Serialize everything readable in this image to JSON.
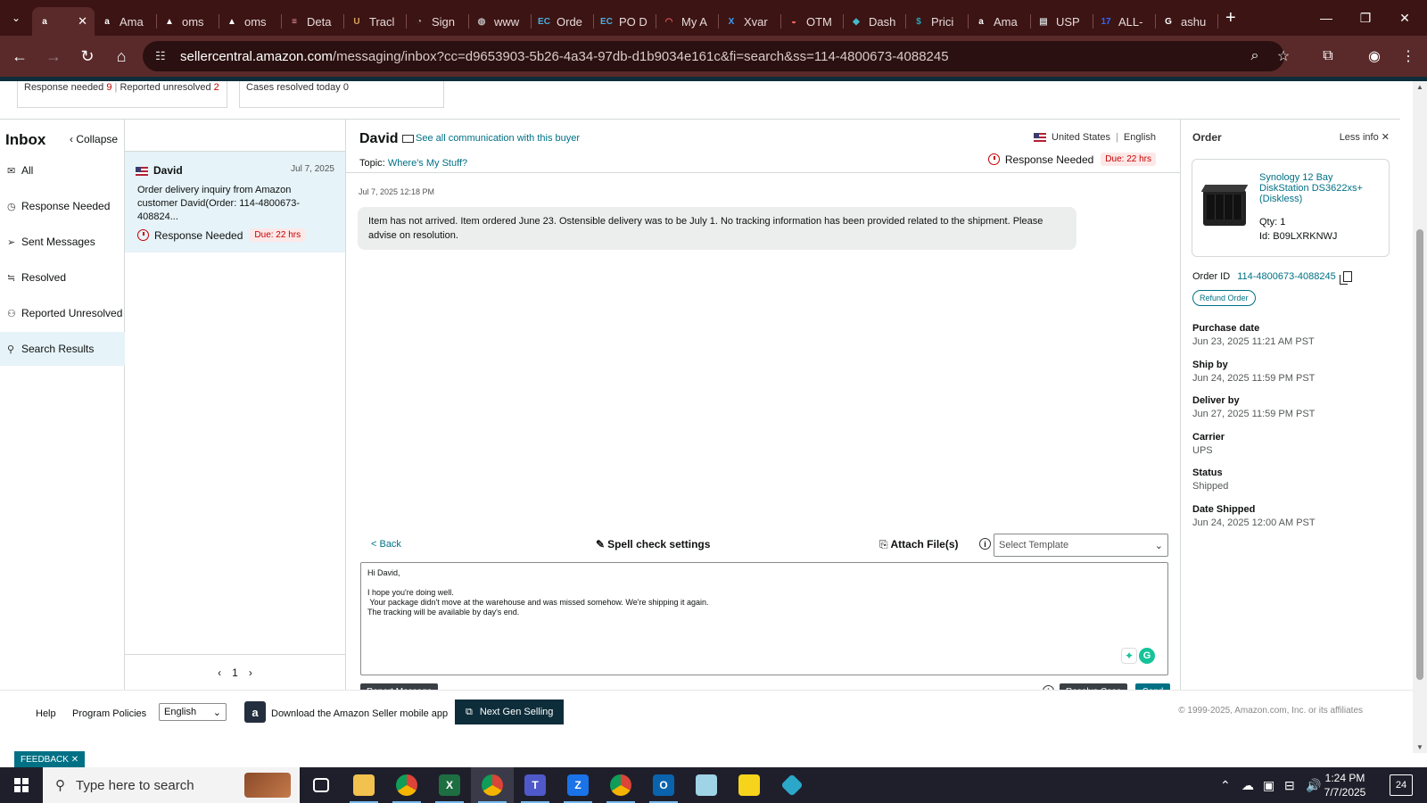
{
  "browser": {
    "tabs": [
      {
        "icon": "a",
        "label": "",
        "color": "#fff"
      },
      {
        "icon": "a",
        "label": "Ama",
        "color": "#fff"
      },
      {
        "icon": "▲",
        "label": "oms",
        "color": "#fff"
      },
      {
        "icon": "▲",
        "label": "oms",
        "color": "#fff"
      },
      {
        "icon": "≡",
        "label": "Deta",
        "color": "#f9a"
      },
      {
        "icon": "U",
        "label": "Tracl",
        "color": "#d9a55a"
      },
      {
        "icon": "◔",
        "label": "Sign",
        "color": "#bbb"
      },
      {
        "icon": "◍",
        "label": "www",
        "color": "#bbb"
      },
      {
        "icon": "EC",
        "label": "Orde",
        "color": "#4ab0e0"
      },
      {
        "icon": "EC",
        "label": "PO D",
        "color": "#4ab0e0"
      },
      {
        "icon": "◠",
        "label": "My A",
        "color": "#e55"
      },
      {
        "icon": "X",
        "label": "Xvar",
        "color": "#3aa0ff"
      },
      {
        "icon": "◒",
        "label": "OTM",
        "color": "#f66"
      },
      {
        "icon": "◆",
        "label": "Dash",
        "color": "#4bc"
      },
      {
        "icon": "$",
        "label": "Prici",
        "color": "#2ab"
      },
      {
        "icon": "a",
        "label": "Ama",
        "color": "#fff"
      },
      {
        "icon": "▤",
        "label": "USP",
        "color": "#ccc"
      },
      {
        "icon": "17",
        "label": "ALL-",
        "color": "#36f"
      },
      {
        "icon": "G",
        "label": "ashu",
        "color": "#fff"
      }
    ],
    "url_host": "sellercentral.amazon.com",
    "url_path": "/messaging/inbox?cc=d9653903-5b26-4a34-97db-d1b9034e161c&fi=search&ss=114-4800673-4088245"
  },
  "stats": {
    "response_needed_label": "Response needed",
    "response_needed_count": "9",
    "reported_unresolved_label": "Reported unresolved",
    "reported_unresolved_count": "2",
    "cases_resolved_label": "Cases resolved today",
    "cases_resolved_count": "0"
  },
  "sidebar": {
    "title": "Inbox",
    "collapse": "Collapse",
    "items": [
      {
        "label": "All",
        "icon": "mail-icon"
      },
      {
        "label": "Response Needed",
        "icon": "clock-icon"
      },
      {
        "label": "Sent Messages",
        "icon": "send-icon"
      },
      {
        "label": "Resolved",
        "icon": "resolved-icon"
      },
      {
        "label": "Reported Unresolved",
        "icon": "report-icon"
      },
      {
        "label": "Search Results",
        "icon": "search-icon"
      }
    ]
  },
  "conversation": {
    "name": "David",
    "date": "Jul 7, 2025",
    "snippet": "Order delivery inquiry from Amazon customer David(Order: 114-4800673-408824...",
    "status": "Response Needed",
    "due": "Due: 22 hrs",
    "page": "1"
  },
  "thread": {
    "buyer": "David",
    "see_all": "See all communication with this buyer",
    "topic_label": "Topic:",
    "topic": "Where's My Stuff?",
    "country": "United States",
    "language": "English",
    "status": "Response Needed",
    "due": "Due: 22 hrs",
    "message_time": "Jul 7, 2025 12:18 PM",
    "message": "Item has not arrived.  Item ordered June 23.  Ostensible delivery was to be July 1.  No tracking information has been provided related to the shipment.  Please advise on resolution."
  },
  "composer": {
    "back": "< Back",
    "spell": "Spell check settings",
    "attach": "Attach File(s)",
    "template_placeholder": "Select Template",
    "reply_lines": [
      "Hi David,",
      "",
      "I hope you're doing well.",
      " Your package didn't move at the warehouse and was missed somehow. We're shipping it again.",
      "The tracking will be available by day's end."
    ],
    "report": "Report Message",
    "resolve": "Resolve Case",
    "send": "Send"
  },
  "order": {
    "title": "Order",
    "less_info": "Less info",
    "product_title": "Synology 12 Bay DiskStation DS3622xs+ (Diskless)",
    "qty_label": "Qty:",
    "qty": "1",
    "id_label": "Id:",
    "asin": "B09LXRKNWJ",
    "order_id_label": "Order ID",
    "order_id": "114-4800673-4088245",
    "refund": "Refund Order",
    "fields": [
      {
        "label": "Purchase date",
        "value": "Jun 23, 2025 11:21 AM PST"
      },
      {
        "label": "Ship by",
        "value": "Jun 24, 2025 11:59 PM PST"
      },
      {
        "label": "Deliver by",
        "value": "Jun 27, 2025 11:59 PM PST"
      },
      {
        "label": "Carrier",
        "value": "UPS"
      },
      {
        "label": "Status",
        "value": "Shipped"
      },
      {
        "label": "Date Shipped",
        "value": "Jun 24, 2025 12:00 AM PST"
      }
    ]
  },
  "footer": {
    "help": "Help",
    "policies": "Program Policies",
    "language": "English",
    "app": "Download the Amazon Seller mobile app",
    "next_gen": "Next Gen Selling",
    "copyright": "© 1999-2025, Amazon.com, Inc. or its affiliates",
    "feedback": "FEEDBACK"
  },
  "taskbar": {
    "search_placeholder": "Type here to search",
    "time": "1:24 PM",
    "date": "7/7/2025",
    "notifications": "24"
  },
  "colors": {
    "accent_teal": "#007185",
    "due_red": "#c40000",
    "browser_frame": "#3c1414"
  }
}
